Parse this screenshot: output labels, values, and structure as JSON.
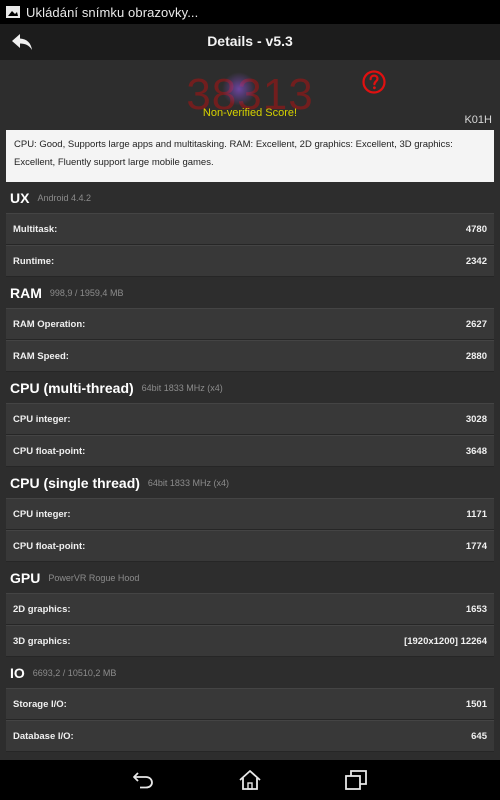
{
  "status_bar": {
    "text": "Ukládání snímku obrazovky..."
  },
  "header": {
    "title": "Details - v5.3"
  },
  "score": {
    "value": "38313",
    "note": "Non-verified Score!",
    "device": "K01H"
  },
  "summary": "CPU: Good, Supports large apps and multitasking. RAM: Excellent, 2D graphics: Excellent, 3D graphics: Excellent, Fluently support large mobile games.",
  "sections": [
    {
      "title": "UX",
      "sub": "Android 4.4.2",
      "rows": [
        {
          "label": "Multitask:",
          "value": "4780"
        },
        {
          "label": "Runtime:",
          "value": "2342"
        }
      ]
    },
    {
      "title": "RAM",
      "sub": "998,9 / 1959,4 MB",
      "rows": [
        {
          "label": "RAM Operation:",
          "value": "2627"
        },
        {
          "label": "RAM Speed:",
          "value": "2880"
        }
      ]
    },
    {
      "title": "CPU (multi-thread)",
      "sub": "64bit 1833 MHz (x4)",
      "rows": [
        {
          "label": "CPU integer:",
          "value": "3028"
        },
        {
          "label": "CPU float-point:",
          "value": "3648"
        }
      ]
    },
    {
      "title": "CPU (single thread)",
      "sub": "64bit 1833 MHz (x4)",
      "rows": [
        {
          "label": "CPU integer:",
          "value": "1171"
        },
        {
          "label": "CPU float-point:",
          "value": "1774"
        }
      ]
    },
    {
      "title": "GPU",
      "sub": "PowerVR Rogue Hood",
      "rows": [
        {
          "label": "2D graphics:",
          "value": "1653"
        },
        {
          "label": "3D graphics:",
          "value": "[1920x1200] 12264"
        }
      ]
    },
    {
      "title": "IO",
      "sub": "6693,2 / 10510,2 MB",
      "rows": [
        {
          "label": "Storage I/O:",
          "value": "1501"
        },
        {
          "label": "Database I/O:",
          "value": "645"
        }
      ]
    }
  ],
  "icons": {
    "notification": "image-icon",
    "back": "back-arrow-icon",
    "help": "question-mark-icon",
    "nav_back": "nav-back-icon",
    "nav_home": "home-icon",
    "nav_recent": "recent-apps-icon"
  },
  "colors": {
    "score": "#7a1d1d",
    "note": "#d6d200",
    "help": "#e01010"
  }
}
